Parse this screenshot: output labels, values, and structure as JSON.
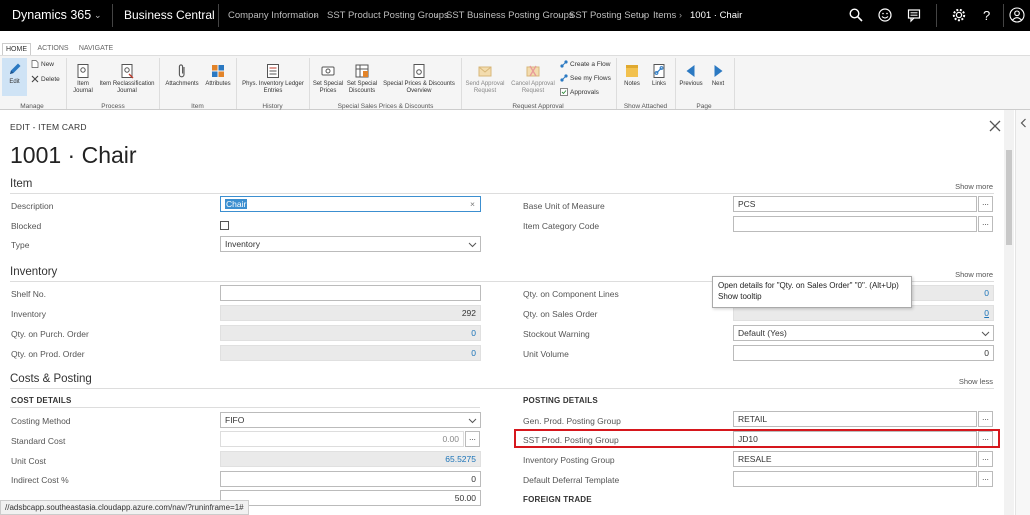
{
  "topbar": {
    "product": "Dynamics 365",
    "app": "Business Central",
    "breadcrumbs": [
      "Company Information",
      "SST Product Posting Groups",
      "SST Business Posting Groups",
      "SST Posting Setup",
      "Items"
    ],
    "current": "1001 · Chair",
    "icons": [
      "search-icon",
      "smiley-icon",
      "comment-icon",
      "gear-icon",
      "help-icon",
      "user-icon"
    ]
  },
  "ribbon": {
    "tabs": [
      "HOME",
      "ACTIONS",
      "NAVIGATE"
    ],
    "buttons": {
      "edit": "Edit",
      "new": "New",
      "delete": "Delete",
      "item_journal": "Item\nJournal",
      "item_reclass": "Item Reclassification\nJournal",
      "attachments": "Attachments",
      "attributes": "Attributes",
      "phys_inv": "Phys. Inventory Ledger\nEntries",
      "set_special_prices": "Set Special\nPrices",
      "set_special_discounts": "Set Special\nDiscounts",
      "special_overview": "Special Prices & Discounts\nOverview",
      "send_approval": "Send Approval\nRequest",
      "cancel_approval": "Cancel Approval\nRequest",
      "create_flow": "Create a Flow",
      "see_flows": "See my Flows",
      "approvals": "Approvals",
      "notes": "Notes",
      "links": "Links",
      "previous": "Previous",
      "next": "Next"
    },
    "groups": {
      "manage": "Manage",
      "process": "Process",
      "item": "Item",
      "history": "History",
      "special": "Special Sales Prices & Discounts",
      "approval": "Request Approval",
      "attached": "Show Attached",
      "page": "Page"
    }
  },
  "page": {
    "type": "EDIT - ITEM CARD",
    "title": "1001 · Chair"
  },
  "item": {
    "heading": "Item",
    "show": "Show more",
    "description_label": "Description",
    "description_value": "Chair",
    "blocked_label": "Blocked",
    "type_label": "Type",
    "type_value": "Inventory",
    "base_uom_label": "Base Unit of Measure",
    "base_uom_value": "PCS",
    "category_label": "Item Category Code",
    "category_value": ""
  },
  "inventory": {
    "heading": "Inventory",
    "show": "Show more",
    "shelf_label": "Shelf No.",
    "shelf_value": "",
    "inventory_label": "Inventory",
    "inventory_value": "292",
    "purch_label": "Qty. on Purch. Order",
    "purch_value": "0",
    "prod_label": "Qty. on Prod. Order",
    "prod_value": "0",
    "comp_label": "Qty. on Component Lines",
    "comp_value": "0",
    "sales_label": "Qty. on Sales Order",
    "sales_value": "0",
    "stockout_label": "Stockout Warning",
    "stockout_value": "Default (Yes)",
    "volume_label": "Unit Volume",
    "volume_value": "0"
  },
  "costs": {
    "heading": "Costs & Posting",
    "show": "Show less",
    "cost_details": "COST DETAILS",
    "costing_method_label": "Costing Method",
    "costing_method_value": "FIFO",
    "standard_cost_label": "Standard Cost",
    "standard_cost_value": "0.00",
    "unit_cost_label": "Unit Cost",
    "unit_cost_value": "65.5275",
    "indirect_label": "Indirect Cost %",
    "indirect_value": "0",
    "unit_price_value": "50.00",
    "posting_details": "POSTING DETAILS",
    "gen_prod_label": "Gen. Prod. Posting Group",
    "gen_prod_value": "RETAIL",
    "sst_prod_label": "SST Prod. Posting Group",
    "sst_prod_value": "JD10",
    "inv_posting_label": "Inventory Posting Group",
    "inv_posting_value": "RESALE",
    "deferral_label": "Default Deferral Template",
    "deferral_value": "",
    "foreign_trade": "FOREIGN TRADE"
  },
  "tooltip": {
    "line1": "Open details for \"Qty. on Sales Order\" \"0\". (Alt+Up)",
    "line2": "Show tooltip"
  },
  "statusbar": "//adsbcapp.southeastasia.cloudapp.azure.com/nav/?runinframe=1#",
  "colors": {
    "accent": "#1a73b8",
    "highlight": "#d6171d",
    "topbar": "#000000"
  }
}
